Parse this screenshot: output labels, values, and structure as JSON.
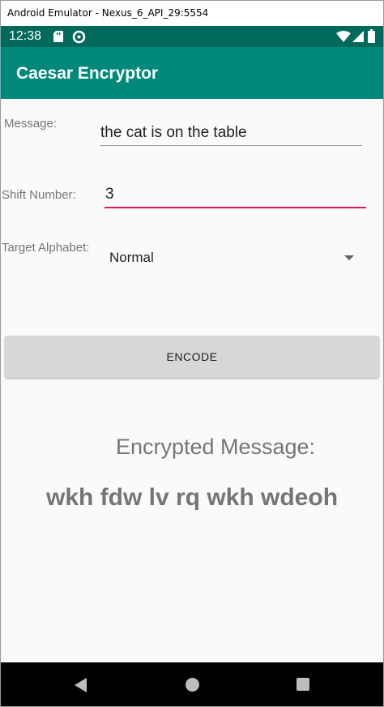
{
  "window": {
    "title": "Android Emulator - Nexus_6_API_29:5554"
  },
  "status_bar": {
    "time": "12:38",
    "icons_left": [
      "sd-card-icon",
      "data-saver-icon"
    ],
    "icons_right": [
      "wifi-icon",
      "signal-icon",
      "battery-icon"
    ]
  },
  "app_bar": {
    "title": "Caesar Encryptor",
    "color": "#00897b",
    "status_color": "#00695c"
  },
  "form": {
    "message_label": "Message:",
    "message_value": "the cat is on the table",
    "shift_label": "Shift Number:",
    "shift_value": "3",
    "alphabet_label": "Target Alphabet:",
    "alphabet_value": "Normal",
    "accent_color": "#d81b60"
  },
  "encode_button": {
    "label": "ENCODE"
  },
  "result": {
    "title": "Encrypted Message:",
    "value": "wkh fdw lv rq wkh wdeoh"
  },
  "nav_bar": {
    "icons": [
      "back-icon",
      "home-icon",
      "recents-icon"
    ]
  }
}
